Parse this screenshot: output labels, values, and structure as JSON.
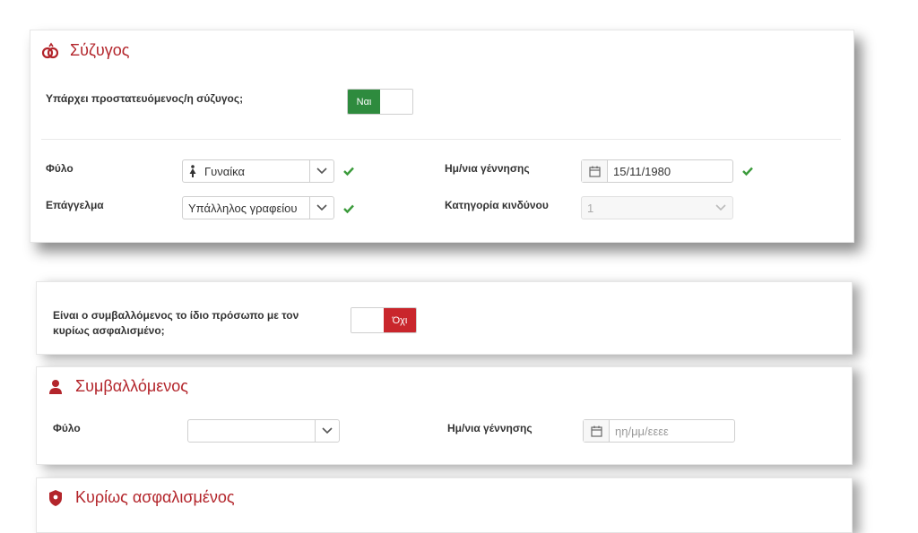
{
  "spouse": {
    "title": "Σύζυγος",
    "has_spouse_label": "Υπάρχει προστατευόμενος/η σύζυγος;",
    "has_spouse_toggle": "Ναι",
    "gender_label": "Φύλο",
    "gender_value": "Γυναίκα",
    "dob_label": "Ημ/νια γέννησης",
    "dob_value": "15/11/1980",
    "occupation_label": "Επάγγελμα",
    "occupation_value": "Υπάλληλος γραφείου",
    "risk_label": "Κατηγορία κινδύνου",
    "risk_value": "1"
  },
  "question": {
    "same_person_label": "Είναι ο συμβαλλόμενος το ίδιο πρόσωπο με τον κυρίως ασφαλισμένο;",
    "same_person_toggle": "Όχι"
  },
  "contracting": {
    "title": "Συμβαλλόμενος",
    "gender_label": "Φύλο",
    "gender_value": "",
    "dob_label": "Ημ/νια γέννησης",
    "dob_placeholder": "ηη/μμ/εεεε"
  },
  "insured": {
    "title": "Κυρίως ασφαλισμένος"
  },
  "colors": {
    "accent_red": "#b3252b",
    "toggle_green": "#2e8b3e",
    "toggle_red": "#c9262c",
    "check_green": "#3a9a3a"
  },
  "icons": {
    "spouse": "rings-icon",
    "contracting": "user-icon",
    "insured": "shield-icon",
    "gender_female": "female-icon",
    "calendar": "calendar-icon",
    "dropdown": "chevron-down-icon",
    "valid": "check-icon"
  }
}
